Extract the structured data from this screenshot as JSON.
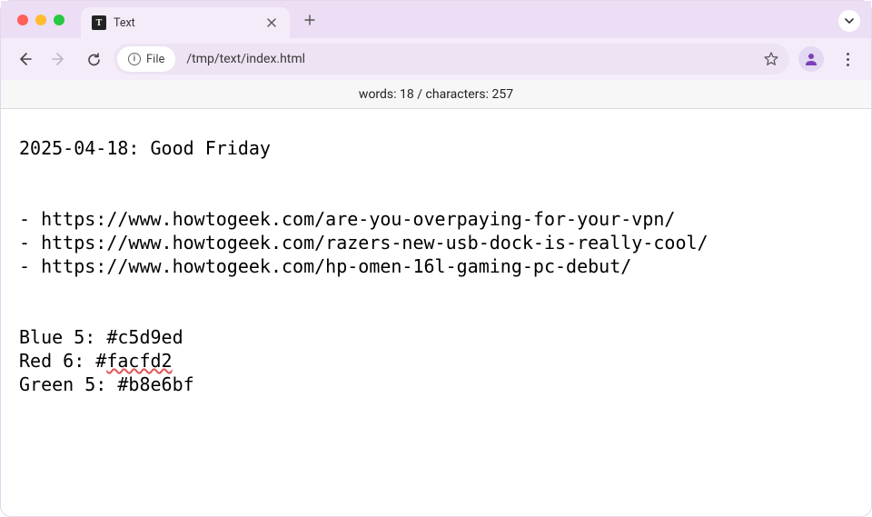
{
  "tab": {
    "title": "Text"
  },
  "address": {
    "scheme_label": "File",
    "path": "/tmp/text/index.html"
  },
  "status": {
    "words_label": "words:",
    "words_value": "18",
    "separator": "/",
    "chars_label": "characters:",
    "chars_value": "257"
  },
  "doc": {
    "heading": "2025-04-18: Good Friday",
    "links": [
      "- https://www.howtogeek.com/are-you-overpaying-for-your-vpn/",
      "- https://www.howtogeek.com/razers-new-usb-dock-is-really-cool/",
      "- https://www.howtogeek.com/hp-omen-16l-gaming-pc-debut/"
    ],
    "colors": {
      "line1_prefix": "Blue 5: #c5d9ed",
      "line2_prefix": "Red 6: #",
      "line2_spell": "facfd2",
      "line3_prefix": "Green 5: #b8e6bf"
    }
  }
}
